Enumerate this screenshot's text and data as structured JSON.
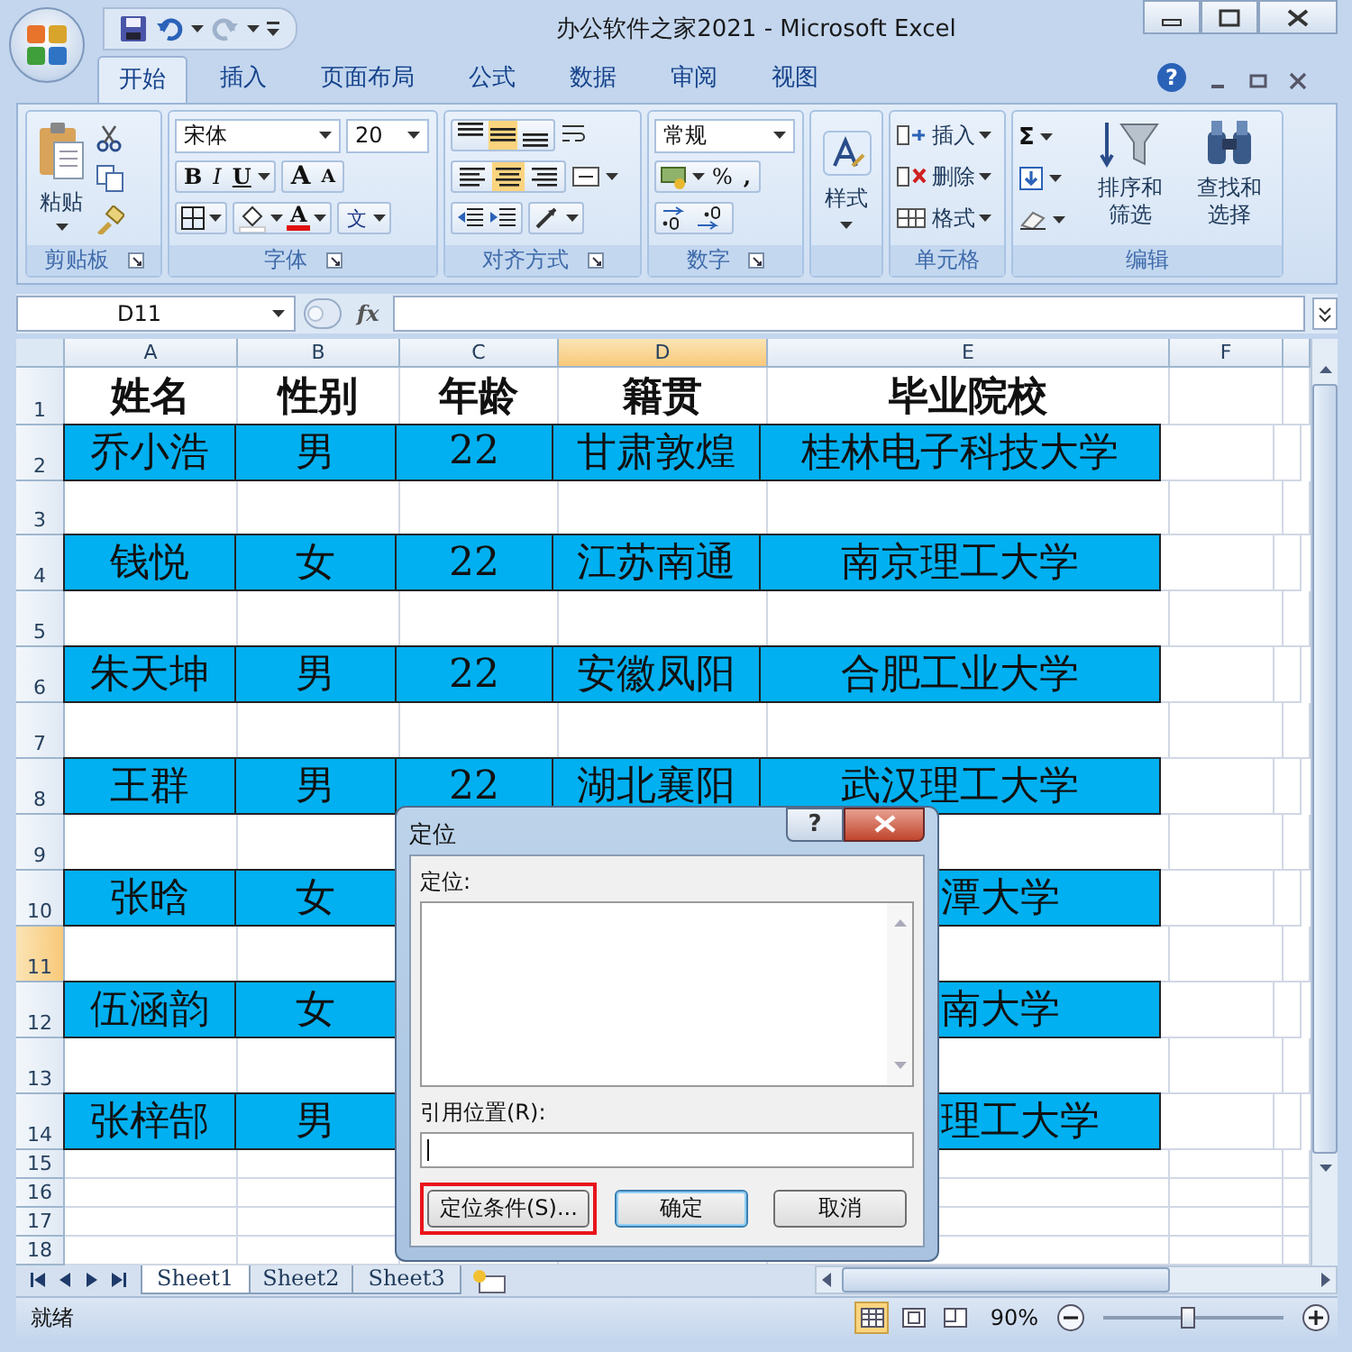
{
  "window": {
    "title": "办公软件之家2021 - Microsoft Excel"
  },
  "tabs": [
    {
      "label": "开始",
      "selected": true
    },
    {
      "label": "插入",
      "selected": false
    },
    {
      "label": "页面布局",
      "selected": false
    },
    {
      "label": "公式",
      "selected": false
    },
    {
      "label": "数据",
      "selected": false
    },
    {
      "label": "审阅",
      "selected": false
    },
    {
      "label": "视图",
      "selected": false
    }
  ],
  "help": "?",
  "ribbon": {
    "clipboard": {
      "label": "剪贴板",
      "paste": "粘贴"
    },
    "font": {
      "label": "字体",
      "name": "宋体",
      "size": "20",
      "style_buttons": [
        "B",
        "I",
        "U"
      ],
      "size_buttons": [
        "A",
        "A"
      ],
      "font_color": "A",
      "phonetic": "文"
    },
    "alignment": {
      "label": "对齐方式",
      "vertical": [
        {
          "selected": false
        },
        {
          "selected": true
        },
        {
          "selected": false
        }
      ],
      "horizontal": [
        {
          "selected": false
        },
        {
          "selected": true
        },
        {
          "selected": false
        }
      ]
    },
    "number": {
      "label": "数字",
      "format": "常规",
      "buttons": [
        "%",
        ","
      ]
    },
    "styles": {
      "label": "样式"
    },
    "cells": {
      "label": "单元格",
      "items": [
        {
          "kind": "insert",
          "label": "插入"
        },
        {
          "kind": "delete",
          "label": "删除"
        },
        {
          "kind": "format",
          "label": "格式"
        }
      ]
    },
    "editing": {
      "label": "编辑",
      "sum": "Σ",
      "sort": [
        "排序和",
        "筛选"
      ],
      "find": [
        "查找和",
        "选择"
      ]
    }
  },
  "formula_bar": {
    "name_box": "D11",
    "function_label": "fx"
  },
  "sheet": {
    "columns": [
      {
        "label": "A",
        "selected": false
      },
      {
        "label": "B",
        "selected": false
      },
      {
        "label": "C",
        "selected": false
      },
      {
        "label": "D",
        "selected": true
      },
      {
        "label": "E",
        "selected": false
      },
      {
        "label": "F",
        "selected": false
      }
    ],
    "rows": [
      {
        "number": "1",
        "selected": false,
        "kind": "header",
        "cells": [
          "姓名",
          "性别",
          "年龄",
          "籍贯",
          "毕业院校"
        ]
      },
      {
        "number": "2",
        "selected": false,
        "kind": "filled",
        "cells": [
          "乔小浩",
          "男",
          "22",
          "甘肃敦煌",
          "桂林电子科技大学"
        ]
      },
      {
        "number": "3",
        "selected": false,
        "kind": "blank",
        "cells": []
      },
      {
        "number": "4",
        "selected": false,
        "kind": "filled",
        "cells": [
          "钱悦",
          "女",
          "22",
          "江苏南通",
          "南京理工大学"
        ]
      },
      {
        "number": "5",
        "selected": false,
        "kind": "blank",
        "cells": []
      },
      {
        "number": "6",
        "selected": false,
        "kind": "filled",
        "cells": [
          "朱天坤",
          "男",
          "22",
          "安徽凤阳",
          "合肥工业大学"
        ]
      },
      {
        "number": "7",
        "selected": false,
        "kind": "blank",
        "cells": []
      },
      {
        "number": "8",
        "selected": false,
        "kind": "filled",
        "cells": [
          "王群",
          "男",
          "22",
          "湖北襄阳",
          "武汉理工大学"
        ]
      },
      {
        "number": "9",
        "selected": false,
        "kind": "blank_covered",
        "cells": []
      },
      {
        "number": "10",
        "selected": false,
        "kind": "covered",
        "cells": [
          "张晗",
          "女",
          "潭大学"
        ]
      },
      {
        "number": "11",
        "selected": true,
        "kind": "blank_covered",
        "cells": []
      },
      {
        "number": "12",
        "selected": false,
        "kind": "covered",
        "cells": [
          "伍涵韵",
          "女",
          "南大学"
        ]
      },
      {
        "number": "13",
        "selected": false,
        "kind": "blank_covered",
        "cells": []
      },
      {
        "number": "14",
        "selected": false,
        "kind": "covered",
        "cells": [
          "张梓郜",
          "男",
          "理工大学"
        ]
      },
      {
        "number": "15",
        "selected": false,
        "kind": "short_covered",
        "cells": []
      },
      {
        "number": "16",
        "selected": false,
        "kind": "short_covered",
        "cells": []
      },
      {
        "number": "17",
        "selected": false,
        "kind": "short_covered",
        "cells": []
      },
      {
        "number": "18",
        "selected": false,
        "kind": "short_covered",
        "cells": []
      }
    ]
  },
  "dialog": {
    "title": "定位",
    "help": "?",
    "list_label": "定位:",
    "reference_label": "引用位置(R):",
    "buttons": [
      {
        "label": "定位条件(S)...",
        "kind": "plain",
        "highlighted": true
      },
      {
        "label": "确定",
        "kind": "default",
        "highlighted": false
      },
      {
        "label": "取消",
        "kind": "plain",
        "highlighted": false
      }
    ]
  },
  "sheet_tabs": [
    {
      "label": "Sheet1",
      "selected": true
    },
    {
      "label": "Sheet2",
      "selected": false
    },
    {
      "label": "Sheet3",
      "selected": false
    }
  ],
  "status_bar": {
    "status": "就绪",
    "views": [
      {
        "kind": "normal",
        "selected": true
      },
      {
        "kind": "layout",
        "selected": false
      },
      {
        "kind": "pagebreak",
        "selected": false
      }
    ],
    "zoom": "90%",
    "zoom_slider": {
      "level": 0.47
    }
  }
}
